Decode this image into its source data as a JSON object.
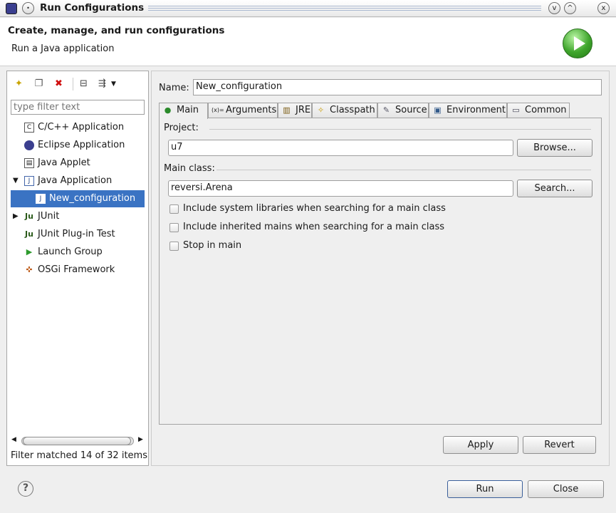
{
  "window": {
    "title": "Run Configurations",
    "minimize": "v",
    "maximize": "^",
    "close": "x"
  },
  "header": {
    "title": "Create, manage, and run configurations",
    "subtitle": "Run a Java application"
  },
  "left": {
    "filter_placeholder": "type filter text",
    "tree": [
      {
        "label": "C/C++ Application",
        "icon": "c-app-icon"
      },
      {
        "label": "Eclipse Application",
        "icon": "eclipse-icon"
      },
      {
        "label": "Java Applet",
        "icon": "applet-icon"
      },
      {
        "label": "Java Application",
        "icon": "java-app-icon",
        "expanded": true
      },
      {
        "label": "New_configuration",
        "icon": "java-config-icon",
        "selected": true
      },
      {
        "label": "JUnit",
        "icon": "junit-icon"
      },
      {
        "label": "JUnit Plug-in Test",
        "icon": "junit-plugin-icon"
      },
      {
        "label": "Launch Group",
        "icon": "launch-group-icon"
      },
      {
        "label": "OSGi Framework",
        "icon": "osgi-icon"
      }
    ],
    "status": "Filter matched 14 of 32 items"
  },
  "right": {
    "name_label": "Name:",
    "name_value": "New_configuration",
    "tabs": [
      "Main",
      "Arguments",
      "JRE",
      "Classpath",
      "Source",
      "Environment",
      "Common"
    ],
    "project_label": "Project:",
    "project_value": "u7",
    "browse_label": "Browse...",
    "main_class_label": "Main class:",
    "main_class_value": "reversi.Arena",
    "search_label": "Search...",
    "options": [
      "Include system libraries when searching for a main class",
      "Include inherited mains when searching for a main class",
      "Stop in main"
    ],
    "apply_label": "Apply",
    "revert_label": "Revert"
  },
  "footer": {
    "help": "?",
    "run_label": "Run",
    "close_label": "Close"
  },
  "colors": {
    "selection": "#3a73c3",
    "run_logo": "#3fa52c"
  }
}
